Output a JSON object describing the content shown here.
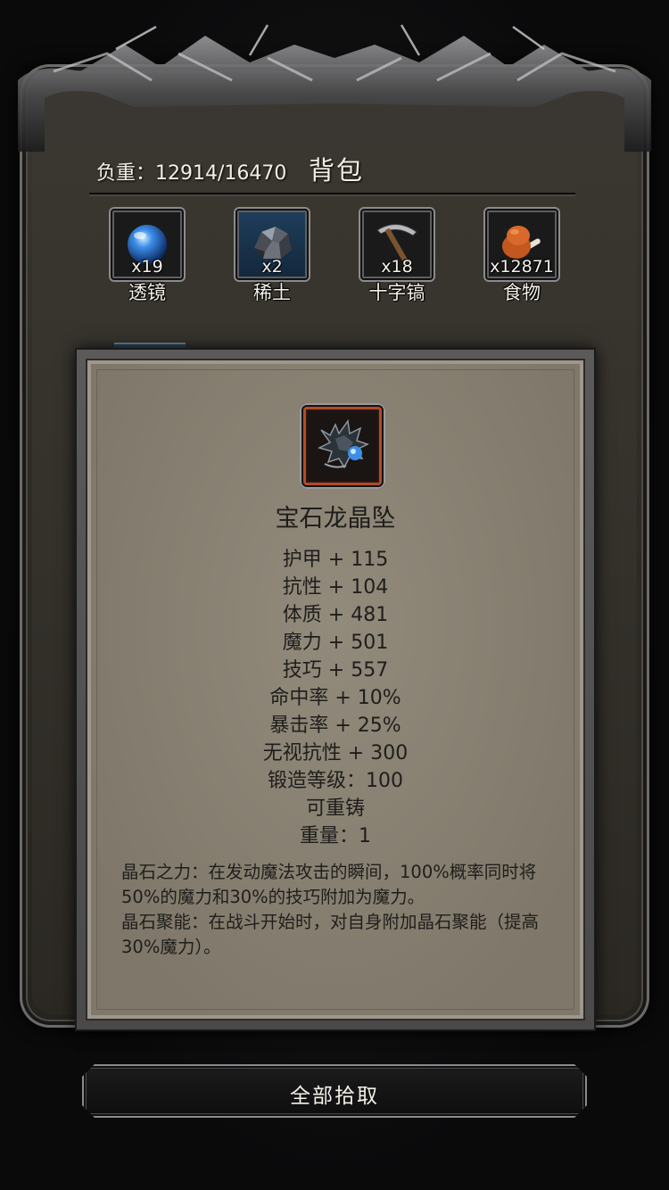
{
  "header": {
    "weight_label": "负重：12914/16470",
    "title": "背包"
  },
  "slots": [
    {
      "count": "x19",
      "name": "透镜",
      "icon": "blue-orb-icon"
    },
    {
      "count": "x2",
      "name": "稀土",
      "icon": "ore-rock-icon"
    },
    {
      "count": "x18",
      "name": "十字镐",
      "icon": "pickaxe-icon"
    },
    {
      "count": "x12871",
      "name": "食物",
      "icon": "meat-icon"
    }
  ],
  "item": {
    "icon": "dragon-pendant-icon",
    "name": "宝石龙晶坠",
    "stats": [
      "护甲 + 115",
      "抗性 + 104",
      "体质 + 481",
      "魔力 + 501",
      "技巧 + 557",
      "命中率 + 10%",
      "暴击率 + 25%",
      "无视抗性 + 300",
      "锻造等级：100",
      "可重铸",
      "重量：1"
    ],
    "description": [
      "晶石之力：在发动魔法攻击的瞬间，100%概率同时将50%的魔力和30%的技巧附加为魔力。",
      "晶石聚能：在战斗开始时，对自身附加晶石聚能（提高30%魔力）。"
    ],
    "rarity_color": "#b24a2a"
  },
  "footer": {
    "collect_all_label": "全部拾取"
  }
}
